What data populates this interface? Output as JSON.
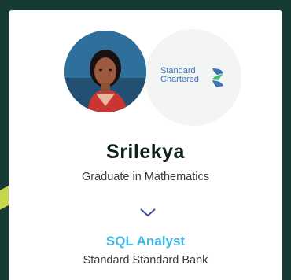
{
  "profile": {
    "name": "Srilekya",
    "degree": "Graduate in Mathematics",
    "role": "SQL Analyst",
    "company": "Standard Standard Bank"
  },
  "logo": {
    "line1": "Standard",
    "line2": "Chartered"
  },
  "icons": {
    "avatar": "person-photo",
    "logo": "standard-chartered-logo",
    "chevron": "chevron-down-icon"
  },
  "colors": {
    "background": "#163b34",
    "accent_stripe": "#c7d64a",
    "role_text": "#3fb8e8",
    "chevron": "#3d4aa3",
    "logo_blue": "#3f72b6",
    "logo_green": "#3ec16a"
  }
}
